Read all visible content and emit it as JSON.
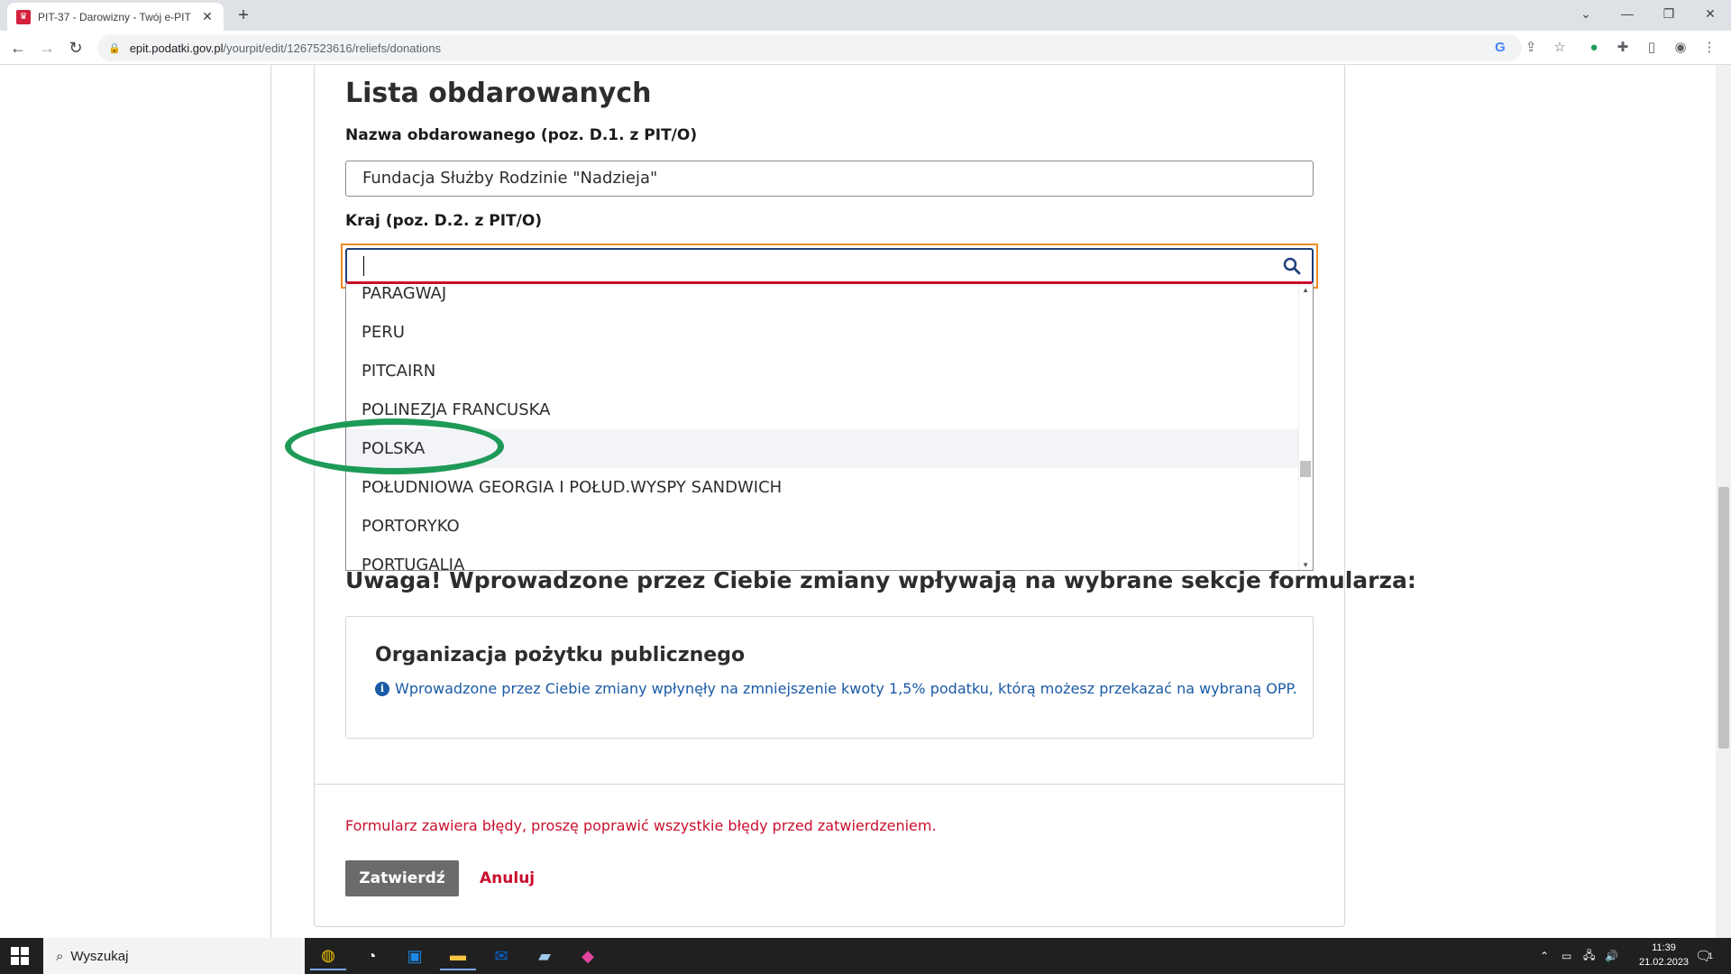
{
  "browser": {
    "tab_title": "PIT-37 - Darowizny - Twój e-PIT",
    "tab_close": "✕",
    "new_tab": "+",
    "url_host": "epit.podatki.gov.pl",
    "url_path": "/yourpit/edit/1267523616/reliefs/donations"
  },
  "page": {
    "heading": "Lista obdarowanych",
    "name_label": "Nazwa obdarowanego (poz. D.1. z PIT/O)",
    "name_value": "Fundacja Służby Rodzinie \"Nadzieja\"",
    "country_label": "Kraj (poz. D.2. z PIT/O)",
    "country_value": "",
    "country_options": [
      "PARAGWAJ",
      "PERU",
      "PITCAIRN",
      "POLINEZJA FRANCUSKA",
      "POLSKA",
      "POŁUDNIOWA GEORGIA I POŁUD.WYSPY SANDWICH",
      "PORTORYKO",
      "PORTUGALIA"
    ],
    "highlighted_option": "POLSKA",
    "warning": "Uwaga! Wprowadzone przez Ciebie zmiany wpływają na wybrane sekcje formularza:",
    "info_title": "Organizacja pożytku publicznego",
    "info_text": "Wprowadzone przez Ciebie zmiany wpłynęły na zmniejszenie kwoty 1,5% podatku, którą możesz przekazać na wybraną OPP.",
    "error_text": "Formularz zawiera błędy, proszę poprawić wszystkie błędy przed zatwierdzeniem.",
    "submit_label": "Zatwierdź",
    "cancel_label": "Anuluj"
  },
  "taskbar": {
    "search_label": "Wyszukaj",
    "time": "11:39",
    "date": "21.02.2023",
    "notification_count": "1"
  },
  "colors": {
    "accent_red": "#c8102e",
    "annotation_green": "#1e9a57",
    "focus_orange": "#f08a24",
    "info_blue": "#1a5aa6"
  }
}
